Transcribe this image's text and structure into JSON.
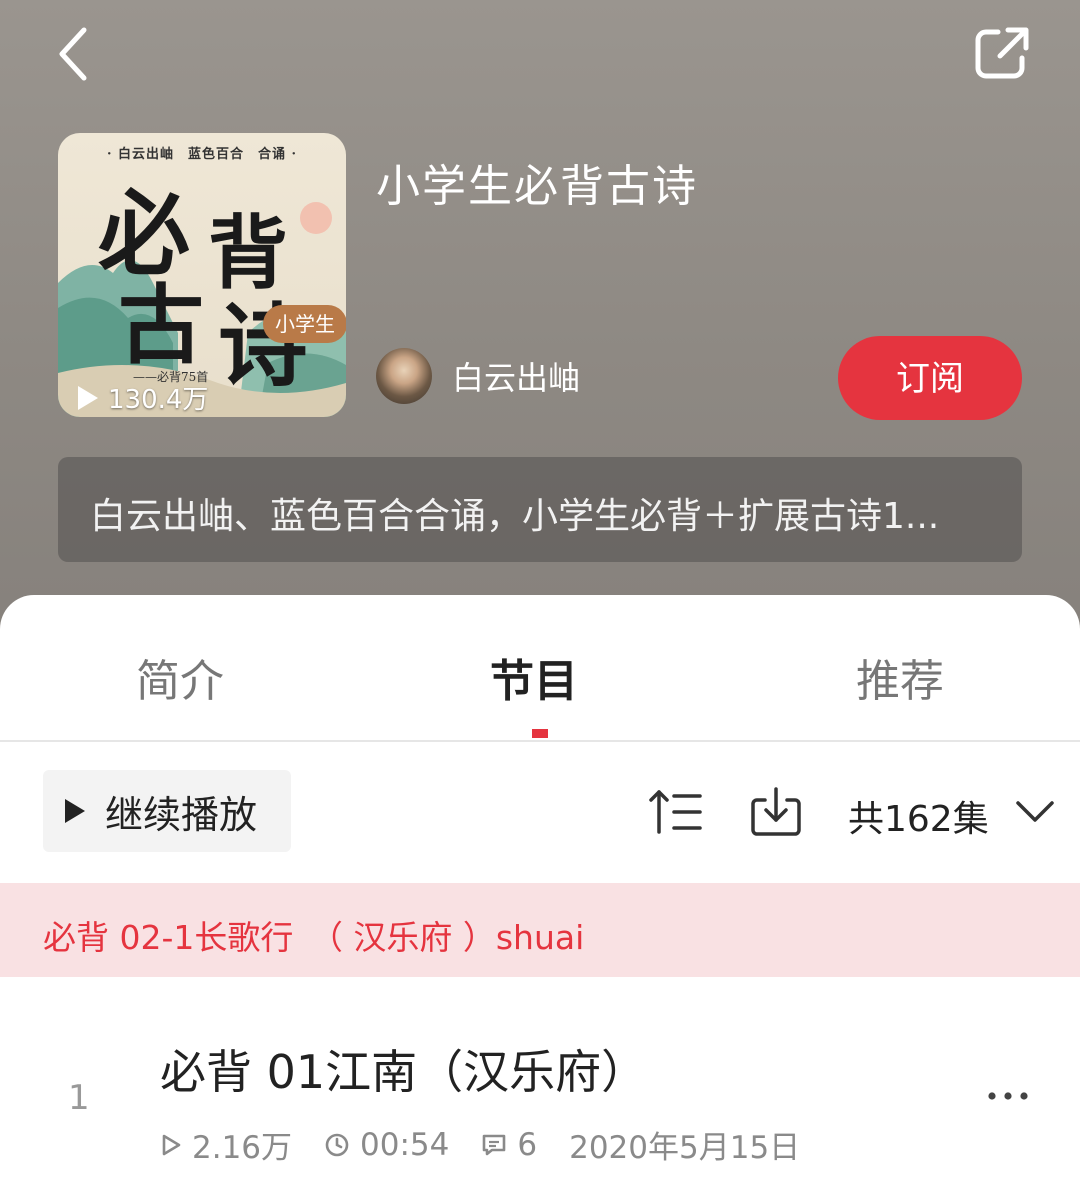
{
  "header": {
    "title": "小学生必背古诗",
    "play_count": "130.4万",
    "author": "白云出岫",
    "subscribe_label": "订阅",
    "description": "白云出岫、蓝色百合合诵，小学生必背＋扩展古诗1..."
  },
  "cover": {
    "top_line": "· 白云出岫　蓝色百合　合诵 ·",
    "badge": "小学生",
    "big_chars": [
      "必",
      "背",
      "古",
      "诗"
    ],
    "sub": "——必背75首"
  },
  "tabs": [
    {
      "label": "简介",
      "active": false
    },
    {
      "label": "节目",
      "active": true
    },
    {
      "label": "推荐",
      "active": false
    }
  ],
  "toolbar": {
    "continue_label": "继续播放",
    "episode_count": "共162集"
  },
  "now_playing": "必背 02-1长歌行　（ 汉乐府 ）shuai",
  "episode": {
    "index": "1",
    "title": "必背 01江南（汉乐府）",
    "plays": "2.16万",
    "duration": "00:54",
    "comments": "6",
    "date": "2020年5月15日"
  },
  "colors": {
    "accent": "#e5343f",
    "now_playing_bg": "#f9e1e3",
    "header_bg": "#8e8983"
  },
  "icons": [
    "back-icon",
    "share-icon",
    "play-icon",
    "sort-icon",
    "download-icon",
    "chevron-down-icon",
    "clock-icon",
    "comment-icon",
    "more-icon"
  ]
}
